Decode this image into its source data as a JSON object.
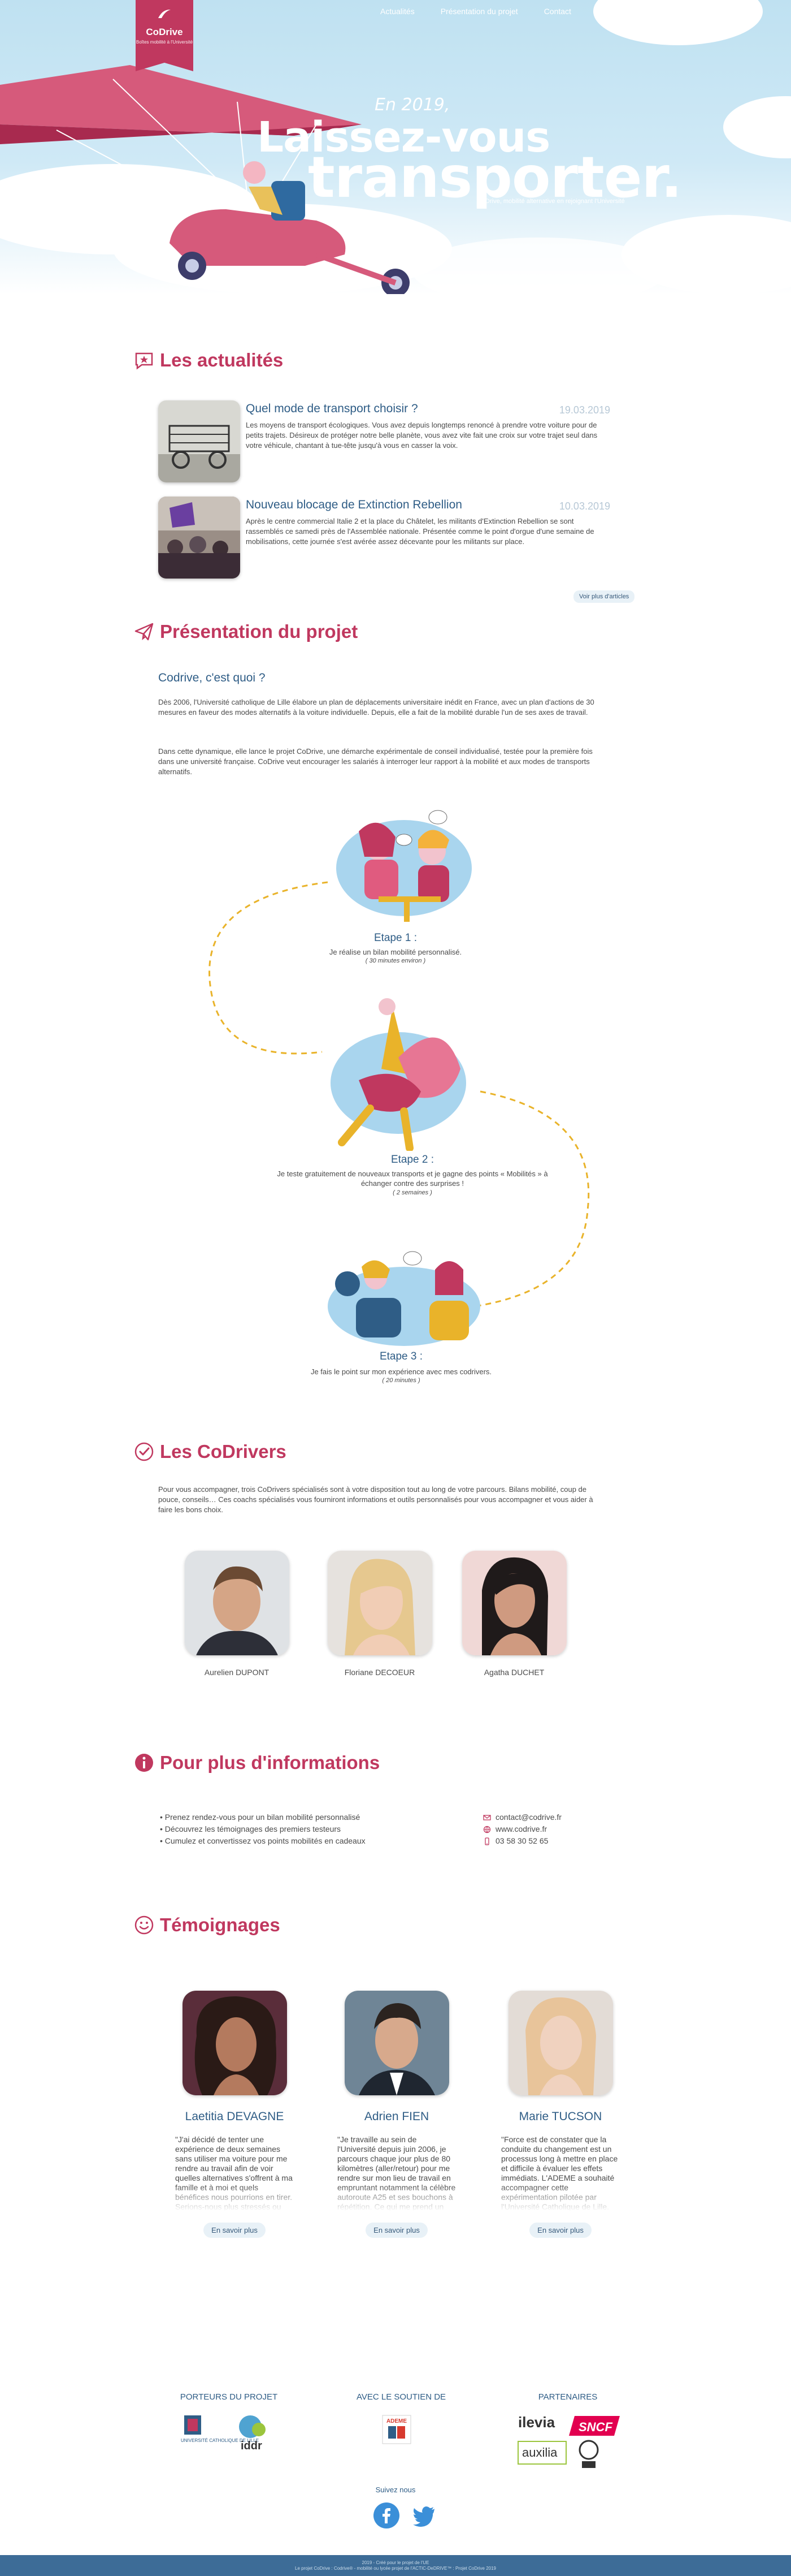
{
  "brand": {
    "name": "CoDrive",
    "tagline": "Boîtes mobilité à l'Université",
    "primary_color": "#c0385f",
    "accent_color": "#2f5d86"
  },
  "nav": {
    "items": [
      "Actualités",
      "Présentation du projet",
      "Contact",
      "Témoignages"
    ]
  },
  "hero": {
    "date": "En 2019,",
    "title_line1": "Laissez-vous",
    "title_line2": "transporter.",
    "subtitle": "CoDrive, mobilité alternative en rejoignant l'Université"
  },
  "news": {
    "title": "Les actualités",
    "items": [
      {
        "title": "Quel mode de transport choisir ?",
        "date": "19.03.2019",
        "text": "Les moyens de transport écologiques. Vous avez depuis longtemps renoncé à prendre votre voiture pour de petits trajets. Désireux de protéger notre belle planète, vous avez vite fait une croix sur votre trajet seul dans votre véhicule, chantant à tue-tête jusqu'à vous en casser la voix."
      },
      {
        "title": "Nouveau blocage de Extinction Rebellion",
        "date": "10.03.2019",
        "text": "Après le centre commercial Italie 2 et la place du Châtelet, les militants d'Extinction Rebellion se sont rassemblés ce samedi près de l'Assemblée nationale. Présentée comme le point d'orgue d'une semaine de mobilisations, cette journée s'est avérée assez décevante pour les militants sur place."
      }
    ],
    "more": "Voir plus d'articles"
  },
  "project": {
    "title": "Présentation du projet",
    "subtitle": "Codrive, c'est quoi ?",
    "paragraph1": "Dès 2006, l'Université catholique de Lille élabore un plan de déplacements universitaire inédit en France, avec un plan d'actions de 30 mesures en faveur des modes alternatifs à la voiture individuelle. Depuis, elle a fait de la mobilité durable l'un de ses axes de travail.",
    "paragraph2": "Dans cette dynamique, elle lance le projet CoDrive, une démarche expérimentale de conseil individualisé, testée pour la première fois dans une université française. CoDrive veut encourager les salariés à interroger leur rapport à la mobilité et aux modes de transports alternatifs.",
    "steps": [
      {
        "label": "Etape 1 :",
        "text": "Je réalise un bilan mobilité personnalisé.",
        "duration": "( 30 minutes environ )"
      },
      {
        "label": "Etape 2 :",
        "text": "Je teste gratuitement de nouveaux transports et je gagne des points « Mobilités » à échanger contre des surprises !",
        "duration": "( 2 semaines )"
      },
      {
        "label": "Etape 3 :",
        "text": "Je fais le point sur mon expérience avec mes codrivers.",
        "duration": "( 20 minutes )"
      }
    ]
  },
  "codrivers": {
    "title": "Les CoDrivers",
    "intro": "Pour vous accompagner, trois CoDrivers spécialisés sont à votre disposition tout au long de votre parcours. Bilans mobilité, coup de pouce, conseils… Ces coachs spécialisés vous fourniront informations et outils personnalisés pour vous accompagner et vous aider à faire les bons choix.",
    "people": [
      "Aurelien DUPONT",
      "Floriane DECOEUR",
      "Agatha DUCHET"
    ]
  },
  "info": {
    "title": "Pour plus d'informations",
    "bullets": [
      "• Prenez rendez-vous pour un bilan mobilité personnalisé",
      "• Découvrez les témoignages des premiers testeurs",
      "• Cumulez et convertissez vos points mobilités en cadeaux"
    ],
    "email": "contact@codrive.fr",
    "website": "www.codrive.fr",
    "phone": "03 58 30 52 65"
  },
  "testimonials": {
    "title": "Témoignages",
    "items": [
      {
        "name": "Laetitia DEVAGNE",
        "quote": "\"J'ai décidé de tenter une expérience de deux semaines sans utiliser ma voiture pour me rendre au travail afin de voir quelles alternatives s'offrent à ma famille et à moi et quels bénéfices nous pourrions en tirer. Serions-nous plus stressés ou plus détendus ? Me feriez-elles gagner du temps ? Me feriez-elles économiser de l'argent ?",
        "button": "En savoir plus"
      },
      {
        "name": "Adrien FIEN",
        "quote": "\"Je travaille au sein de l'Université depuis juin 2006, je parcours chaque jour plus de 80 kilomètres (aller/retour) pour me rendre sur mon lieu de travail en empruntant notamment la célèbre autoroute A25 et ses bouchons à répétition. Ce qui me prend un temps considérable.",
        "button": "En savoir plus"
      },
      {
        "name": "Marie TUCSON",
        "quote": "\"Force est de constater que la conduite du changement est un processus long à mettre en place et difficile à évaluer les effets immédiats. L'ADEME a souhaité accompagner cette expérimentation pilotée par l'Université Catholique de Lille. Deuxième paragraphe du témoignage.",
        "button": "En savoir plus"
      }
    ]
  },
  "footer": {
    "col1": "PORTEURS DU PROJET",
    "col2": "AVEC LE SOUTIEN DE",
    "col3": "PARTENAIRES",
    "univ_logo": "UNIVERSITÉ CATHOLIQUE DE LILLE",
    "iddr_logo": "iddr",
    "ademe_logo": "ADEME",
    "ilevia_logo": "ilevia",
    "sncf_logo": "SNCF",
    "auxilia_logo": "auxilia",
    "follow": "Suivez nous",
    "bottom_line1": "2019 - Créé pour le projet de l'UE",
    "bottom_line2": "Le projet CoDrive : Codrive® - mobilité ou lycée projet de l'ACTIC-DeDRIVE™ : Projet CoDrive 2019"
  }
}
